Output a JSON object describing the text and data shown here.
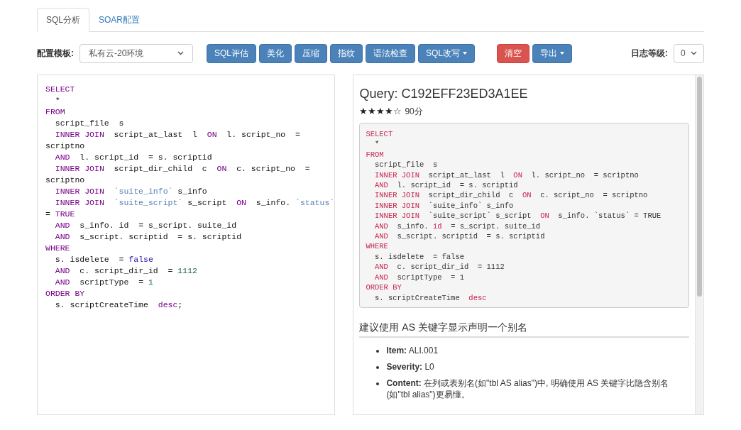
{
  "tabs": [
    {
      "label": "SQL分析",
      "selected": true
    },
    {
      "label": "SOAR配置",
      "selected": false
    }
  ],
  "toolbar": {
    "template_label": "配置模板:",
    "template_value": "私有云-20环境",
    "buttons": [
      {
        "label": "SQL评估",
        "kind": "primary",
        "dropdown": false
      },
      {
        "label": "美化",
        "kind": "primary",
        "dropdown": false
      },
      {
        "label": "压缩",
        "kind": "primary",
        "dropdown": false
      },
      {
        "label": "指纹",
        "kind": "primary",
        "dropdown": false
      },
      {
        "label": "语法检查",
        "kind": "primary",
        "dropdown": false
      },
      {
        "label": "SQL改写",
        "kind": "primary",
        "dropdown": true
      },
      {
        "label": "清空",
        "kind": "danger",
        "dropdown": false
      },
      {
        "label": "导出",
        "kind": "primary",
        "dropdown": true
      }
    ],
    "log_label": "日志等级:",
    "log_value": "0"
  },
  "editor": {
    "lines": [
      {
        "indent": false,
        "tokens": [
          {
            "kind": "keyword",
            "text": "SELECT"
          }
        ]
      },
      {
        "indent": true,
        "tokens": [
          {
            "kind": "plain",
            "text": "*"
          }
        ]
      },
      {
        "indent": false,
        "tokens": [
          {
            "kind": "keyword",
            "text": "FROM"
          }
        ]
      },
      {
        "indent": true,
        "tokens": [
          {
            "kind": "plain",
            "text": "script_file  s"
          }
        ]
      },
      {
        "indent": true,
        "tokens": [
          {
            "kind": "keyword",
            "text": "INNER JOIN"
          },
          {
            "kind": "plain",
            "text": "  script_at_last  l  "
          },
          {
            "kind": "keyword",
            "text": "ON"
          },
          {
            "kind": "plain",
            "text": "  l. script_no  ="
          }
        ]
      },
      {
        "indent": false,
        "tokens": [
          {
            "kind": "plain",
            "text": "scriptno"
          }
        ]
      },
      {
        "indent": true,
        "tokens": [
          {
            "kind": "keyword",
            "text": "AND"
          },
          {
            "kind": "plain",
            "text": "  l. script_id  = s. scriptid"
          }
        ]
      },
      {
        "indent": true,
        "tokens": [
          {
            "kind": "keyword",
            "text": "INNER JOIN"
          },
          {
            "kind": "plain",
            "text": "  script_dir_child  c  "
          },
          {
            "kind": "keyword",
            "text": "ON"
          },
          {
            "kind": "plain",
            "text": "  c. script_no  ="
          }
        ]
      },
      {
        "indent": false,
        "tokens": [
          {
            "kind": "plain",
            "text": "scriptno"
          }
        ]
      },
      {
        "indent": true,
        "tokens": [
          {
            "kind": "keyword",
            "text": "INNER JOIN"
          },
          {
            "kind": "string",
            "text": "  `suite_info`"
          },
          {
            "kind": "plain",
            "text": " s_info"
          }
        ]
      },
      {
        "indent": true,
        "tokens": [
          {
            "kind": "keyword",
            "text": "INNER JOIN"
          },
          {
            "kind": "string",
            "text": "  `suite_script`"
          },
          {
            "kind": "plain",
            "text": " s_script  "
          },
          {
            "kind": "keyword",
            "text": "ON"
          },
          {
            "kind": "plain",
            "text": "  s_info. "
          },
          {
            "kind": "string",
            "text": "`status`"
          }
        ]
      },
      {
        "indent": false,
        "tokens": [
          {
            "kind": "plain",
            "text": "= "
          },
          {
            "kind": "keyword",
            "text": "TRUE"
          }
        ]
      },
      {
        "indent": true,
        "tokens": [
          {
            "kind": "keyword",
            "text": "AND"
          },
          {
            "kind": "plain",
            "text": "  s_info. id  = s_script. suite_id"
          }
        ]
      },
      {
        "indent": true,
        "tokens": [
          {
            "kind": "keyword",
            "text": "AND"
          },
          {
            "kind": "plain",
            "text": "  s_script. scriptid  = s. scriptid"
          }
        ]
      },
      {
        "indent": false,
        "tokens": [
          {
            "kind": "keyword",
            "text": "WHERE"
          }
        ]
      },
      {
        "indent": true,
        "tokens": [
          {
            "kind": "plain",
            "text": "s. isdelete  = "
          },
          {
            "kind": "atom",
            "text": "false"
          }
        ]
      },
      {
        "indent": true,
        "tokens": [
          {
            "kind": "keyword",
            "text": "AND"
          },
          {
            "kind": "plain",
            "text": "  c. script_dir_id  = "
          },
          {
            "kind": "number",
            "text": "1112"
          }
        ]
      },
      {
        "indent": true,
        "tokens": [
          {
            "kind": "keyword",
            "text": "AND"
          },
          {
            "kind": "plain",
            "text": "  scriptType  = "
          },
          {
            "kind": "number",
            "text": "1"
          }
        ]
      },
      {
        "indent": false,
        "tokens": [
          {
            "kind": "keyword",
            "text": "ORDER BY"
          }
        ]
      },
      {
        "indent": true,
        "tokens": [
          {
            "kind": "plain",
            "text": "s. scriptCreateTime  "
          },
          {
            "kind": "keyword",
            "text": "desc"
          },
          {
            "kind": "plain",
            "text": ";"
          }
        ]
      }
    ]
  },
  "result": {
    "title": "Query: C192EFF23ED3A1EE",
    "stars": 4,
    "score": "90分",
    "code": [
      {
        "indent": false,
        "tokens": [
          {
            "kind": "keyword",
            "text": "SELECT"
          }
        ]
      },
      {
        "indent": true,
        "tokens": [
          {
            "kind": "plain",
            "text": "*"
          }
        ]
      },
      {
        "indent": false,
        "tokens": [
          {
            "kind": "keyword",
            "text": "FROM"
          }
        ]
      },
      {
        "indent": true,
        "tokens": [
          {
            "kind": "plain",
            "text": "script_file  s"
          }
        ]
      },
      {
        "indent": true,
        "tokens": [
          {
            "kind": "keyword",
            "text": "INNER JOIN"
          },
          {
            "kind": "plain",
            "text": "  script_at_last  l  "
          },
          {
            "kind": "keyword",
            "text": "ON"
          },
          {
            "kind": "plain",
            "text": "  l. script_no  = scriptno"
          }
        ]
      },
      {
        "indent": true,
        "tokens": [
          {
            "kind": "keyword",
            "text": "AND"
          },
          {
            "kind": "plain",
            "text": "  l. script_id  = s. scriptid"
          }
        ]
      },
      {
        "indent": true,
        "tokens": [
          {
            "kind": "keyword",
            "text": "INNER JOIN"
          },
          {
            "kind": "plain",
            "text": "  script_dir_child  c  "
          },
          {
            "kind": "keyword",
            "text": "ON"
          },
          {
            "kind": "plain",
            "text": "  c. script_no  = scriptno"
          }
        ]
      },
      {
        "indent": true,
        "tokens": [
          {
            "kind": "keyword",
            "text": "INNER JOIN"
          },
          {
            "kind": "plain",
            "text": "  `suite_info` s_info"
          }
        ]
      },
      {
        "indent": true,
        "tokens": [
          {
            "kind": "keyword",
            "text": "INNER JOIN"
          },
          {
            "kind": "plain",
            "text": "  `suite_script` s_script  "
          },
          {
            "kind": "keyword",
            "text": "ON"
          },
          {
            "kind": "plain",
            "text": "  s_info. `status` = TRUE"
          }
        ]
      },
      {
        "indent": true,
        "tokens": [
          {
            "kind": "keyword",
            "text": "AND"
          },
          {
            "kind": "plain",
            "text": "  s_info. "
          },
          {
            "kind": "keyword",
            "text": "id"
          },
          {
            "kind": "plain",
            "text": "  = s_script. suite_id"
          }
        ]
      },
      {
        "indent": true,
        "tokens": [
          {
            "kind": "keyword",
            "text": "AND"
          },
          {
            "kind": "plain",
            "text": "  s_script. scriptid  = s. scriptid"
          }
        ]
      },
      {
        "indent": false,
        "tokens": [
          {
            "kind": "keyword",
            "text": "WHERE"
          }
        ]
      },
      {
        "indent": true,
        "tokens": [
          {
            "kind": "plain",
            "text": "s. isdelete  = false"
          }
        ]
      },
      {
        "indent": true,
        "tokens": [
          {
            "kind": "keyword",
            "text": "AND"
          },
          {
            "kind": "plain",
            "text": "  c. script_dir_id  = 1112"
          }
        ]
      },
      {
        "indent": true,
        "tokens": [
          {
            "kind": "keyword",
            "text": "AND"
          },
          {
            "kind": "plain",
            "text": "  scriptType  = 1"
          }
        ]
      },
      {
        "indent": false,
        "tokens": [
          {
            "kind": "keyword",
            "text": "ORDER BY"
          }
        ]
      },
      {
        "indent": true,
        "tokens": [
          {
            "kind": "plain",
            "text": "s. scriptCreateTime  "
          },
          {
            "kind": "keyword",
            "text": "desc"
          }
        ]
      }
    ],
    "heading": "建议使用 AS 关键字显示声明一个别名",
    "items": [
      "**Item:** ALI.001",
      "**Severity:** L0",
      "**Content:** 在列或表别名(如\"tbl AS alias\")中, 明确使用 AS 关键字比隐含别名(如\"tbl alias\")更易懂。"
    ]
  }
}
